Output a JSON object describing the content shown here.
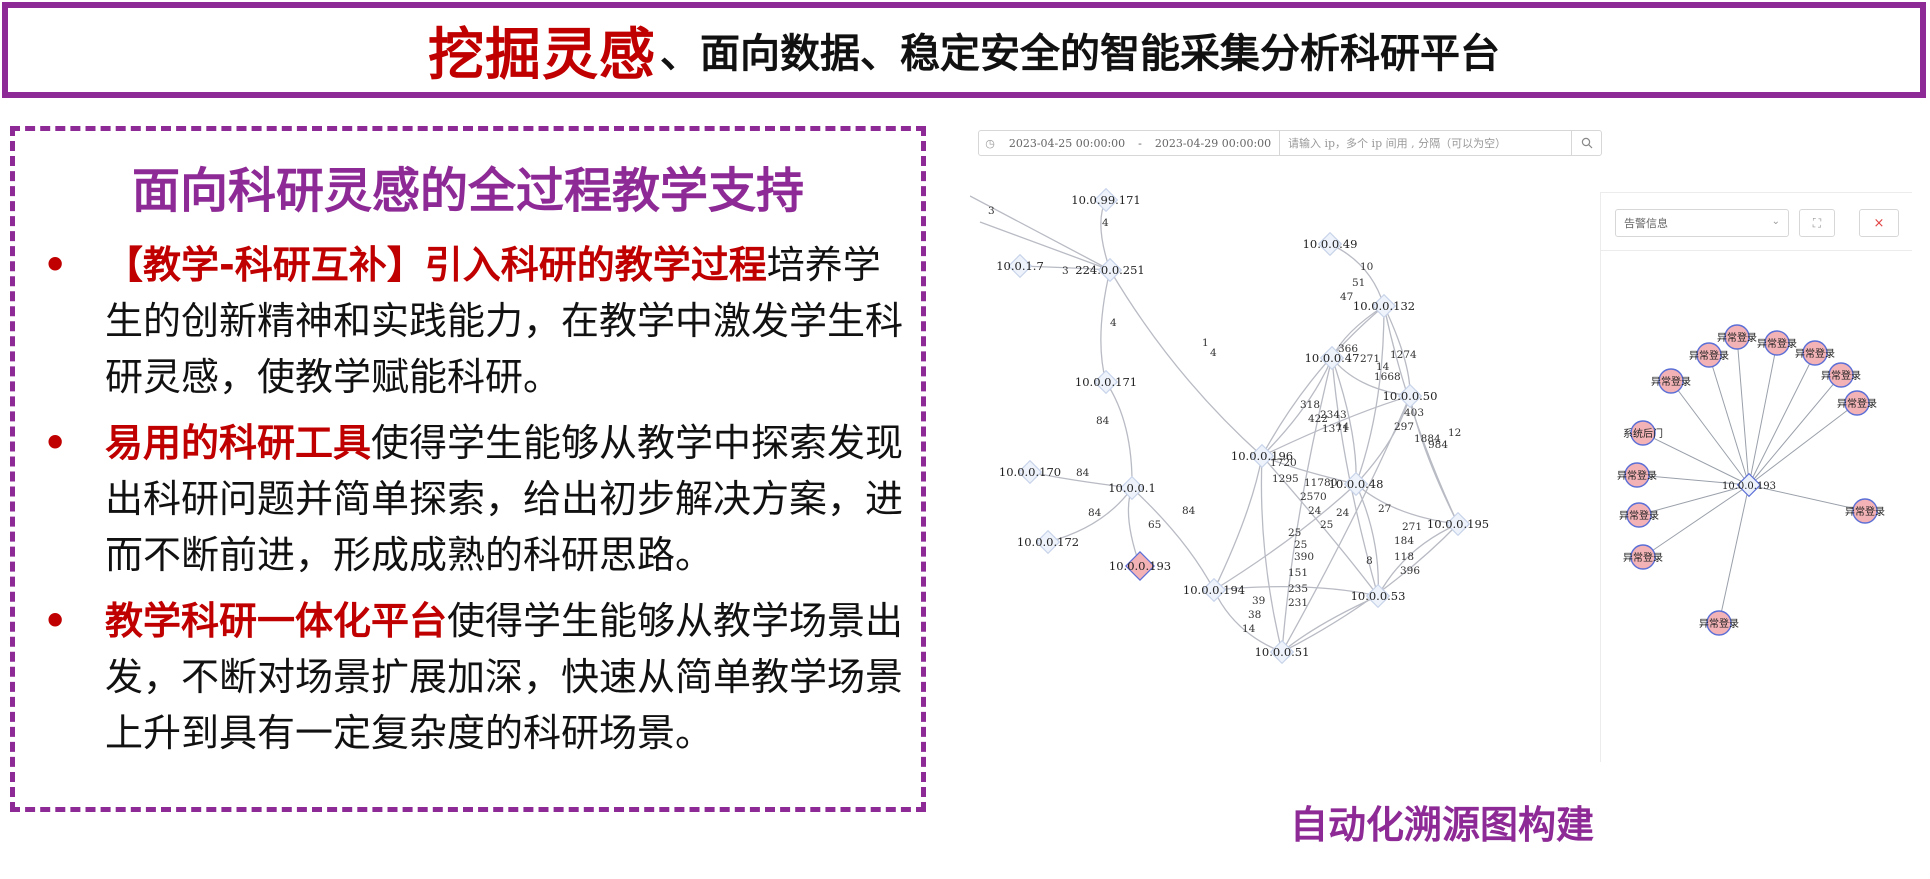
{
  "header": {
    "accent": "挖掘灵感",
    "rest": "、面向数据、稳定安全的智能采集分析科研平台"
  },
  "left_panel": {
    "heading": "面向科研灵感的全过程教学支持",
    "bullets": [
      {
        "marker": "•",
        "lead": "【教学-科研互补】引入科研的教学过程",
        "text": "培养学生的创新精神和实践能力，在教学中激发学生科研灵感，使教学赋能科研。"
      },
      {
        "marker": "•",
        "lead": "易用的科研工具",
        "text": "使得学生能够从教学中探索发现出科研问题并简单探索，给出初步解决方案，进而不断前进，形成成熟的科研思路。"
      },
      {
        "marker": "•",
        "lead": "教学科研一体化平台",
        "text": "使得学生能够从教学场景出发，不断对场景扩展加深，快速从简单教学场景上升到具有一定复杂度的科研场景。"
      }
    ]
  },
  "screen": {
    "filter": {
      "start": "2023-04-25 00:00:00",
      "separator": "-",
      "end": "2023-04-29 00:00:00",
      "ip_placeholder": "请输入 ip，多个 ip 间用 , 分隔（可以为空）"
    },
    "alert_panel": {
      "select_value": "告警信息",
      "close_icon": "×",
      "expand_icon": "⛶"
    },
    "graph": {
      "nodes": [
        {
          "id": "10.0.99.171"
        },
        {
          "id": "10.0.1.7"
        },
        {
          "id": "224.0.0.251"
        },
        {
          "id": "10.0.0.171"
        },
        {
          "id": "10.0.0.170"
        },
        {
          "id": "10.0.0.1"
        },
        {
          "id": "10.0.0.172"
        },
        {
          "id": "10.0.0.193",
          "alert": true
        },
        {
          "id": "10.0.0.194"
        },
        {
          "id": "10.0.0.49"
        },
        {
          "id": "10.0.0.132"
        },
        {
          "id": "10.0.0.47"
        },
        {
          "id": "10.0.0.196"
        },
        {
          "id": "10.0.0.50"
        },
        {
          "id": "10.0.0.48"
        },
        {
          "id": "10.0.0.195"
        },
        {
          "id": "10.0.0.53"
        },
        {
          "id": "10.0.0.51"
        }
      ],
      "edge_labels": [
        "3",
        "3",
        "4",
        "4",
        "84",
        "84",
        "84",
        "65",
        "84",
        "4",
        "10",
        "51",
        "47",
        "366",
        "271",
        "1274",
        "14",
        "1668",
        "318",
        "422",
        "2343",
        "1371",
        "14",
        "403",
        "297",
        "1884",
        "984",
        "12",
        "1720",
        "1295",
        "11780",
        "2570",
        "24",
        "25",
        "25",
        "390",
        "151",
        "235",
        "231",
        "39",
        "38",
        "14",
        "25",
        "24",
        "271",
        "184",
        "118",
        "396",
        "8",
        "27",
        "1"
      ]
    },
    "alert_graph": {
      "center": "10.0.0.193",
      "leaves": [
        "异常登录",
        "异常登录",
        "异常登录",
        "异常登录",
        "异常登录",
        "异常登录",
        "异常登录",
        "系统后门",
        "异常登录",
        "异常登录",
        "异常登录",
        "异常登录",
        "异常登录"
      ]
    }
  },
  "caption": "自动化溯源图构建",
  "colors": {
    "accent": "#c00000",
    "purple": "#8e2a96",
    "node_alert": "#f3b2b5",
    "node_stroke": "#5b6fd6"
  }
}
